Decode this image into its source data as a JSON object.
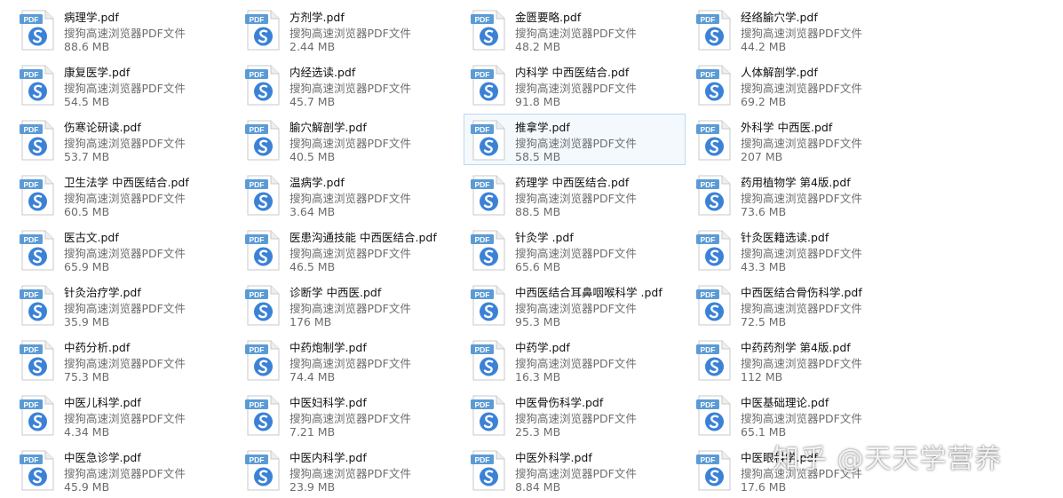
{
  "explorer": {
    "files": [
      {
        "name": "病理学.pdf",
        "type": "搜狗高速浏览器PDF文件",
        "size": "88.6 MB"
      },
      {
        "name": "康复医学.pdf",
        "type": "搜狗高速浏览器PDF文件",
        "size": "54.5 MB"
      },
      {
        "name": "伤寒论研读.pdf",
        "type": "搜狗高速浏览器PDF文件",
        "size": "53.7 MB"
      },
      {
        "name": "卫生法学 中西医结合.pdf",
        "type": "搜狗高速浏览器PDF文件",
        "size": "60.5 MB"
      },
      {
        "name": "医古文.pdf",
        "type": "搜狗高速浏览器PDF文件",
        "size": "65.9 MB"
      },
      {
        "name": "针灸治疗学.pdf",
        "type": "搜狗高速浏览器PDF文件",
        "size": "35.9 MB"
      },
      {
        "name": "中药分析.pdf",
        "type": "搜狗高速浏览器PDF文件",
        "size": "75.3 MB"
      },
      {
        "name": "中医儿科学.pdf",
        "type": "搜狗高速浏览器PDF文件",
        "size": "4.34 MB"
      },
      {
        "name": "中医急诊学.pdf",
        "type": "搜狗高速浏览器PDF文件",
        "size": "45.9 MB"
      },
      {
        "name": "方剂学.pdf",
        "type": "搜狗高速浏览器PDF文件",
        "size": "2.44 MB"
      },
      {
        "name": "内经选读.pdf",
        "type": "搜狗高速浏览器PDF文件",
        "size": "45.7 MB"
      },
      {
        "name": "腧穴解剖学.pdf",
        "type": "搜狗高速浏览器PDF文件",
        "size": "40.5 MB"
      },
      {
        "name": "温病学.pdf",
        "type": "搜狗高速浏览器PDF文件",
        "size": "3.64 MB"
      },
      {
        "name": "医患沟通技能 中西医结合.pdf",
        "type": "搜狗高速浏览器PDF文件",
        "size": "46.5 MB"
      },
      {
        "name": "诊断学 中西医.pdf",
        "type": "搜狗高速浏览器PDF文件",
        "size": "176 MB"
      },
      {
        "name": "中药炮制学.pdf",
        "type": "搜狗高速浏览器PDF文件",
        "size": "74.4 MB"
      },
      {
        "name": "中医妇科学.pdf",
        "type": "搜狗高速浏览器PDF文件",
        "size": "7.21 MB"
      },
      {
        "name": "中医内科学.pdf",
        "type": "搜狗高速浏览器PDF文件",
        "size": "23.9 MB"
      },
      {
        "name": "金匮要略.pdf",
        "type": "搜狗高速浏览器PDF文件",
        "size": "48.2 MB"
      },
      {
        "name": "内科学 中西医结合.pdf",
        "type": "搜狗高速浏览器PDF文件",
        "size": "91.8 MB"
      },
      {
        "name": "推拿学.pdf",
        "type": "搜狗高速浏览器PDF文件",
        "size": "58.5 MB",
        "selected": true
      },
      {
        "name": "药理学 中西医结合.pdf",
        "type": "搜狗高速浏览器PDF文件",
        "size": "88.5 MB"
      },
      {
        "name": "针灸学 .pdf",
        "type": "搜狗高速浏览器PDF文件",
        "size": "65.6 MB"
      },
      {
        "name": "中西医结合耳鼻咽喉科学 .pdf",
        "type": "搜狗高速浏览器PDF文件",
        "size": "95.3 MB"
      },
      {
        "name": "中药学.pdf",
        "type": "搜狗高速浏览器PDF文件",
        "size": "16.3 MB"
      },
      {
        "name": "中医骨伤科学.pdf",
        "type": "搜狗高速浏览器PDF文件",
        "size": "25.3 MB"
      },
      {
        "name": "中医外科学.pdf",
        "type": "搜狗高速浏览器PDF文件",
        "size": "8.84 MB"
      },
      {
        "name": "经络腧穴学.pdf",
        "type": "搜狗高速浏览器PDF文件",
        "size": "44.2 MB"
      },
      {
        "name": "人体解剖学.pdf",
        "type": "搜狗高速浏览器PDF文件",
        "size": "69.2 MB"
      },
      {
        "name": "外科学 中西医.pdf",
        "type": "搜狗高速浏览器PDF文件",
        "size": "207 MB"
      },
      {
        "name": "药用植物学  第4版.pdf",
        "type": "搜狗高速浏览器PDF文件",
        "size": "73.6 MB"
      },
      {
        "name": "针灸医籍选读.pdf",
        "type": "搜狗高速浏览器PDF文件",
        "size": "43.3 MB"
      },
      {
        "name": "中西医结合骨伤科学.pdf",
        "type": "搜狗高速浏览器PDF文件",
        "size": "72.5 MB"
      },
      {
        "name": "中药药剂学  第4版.pdf",
        "type": "搜狗高速浏览器PDF文件",
        "size": "112 MB"
      },
      {
        "name": "中医基础理论.pdf",
        "type": "搜狗高速浏览器PDF文件",
        "size": "65.1 MB"
      },
      {
        "name": "中医眼科学.pdf",
        "type": "搜狗高速浏览器PDF文件",
        "size": "17.6 MB"
      }
    ]
  },
  "icon": {
    "label": "PDF",
    "badge_color": "#5b9bd5",
    "accent": "#3b82d6"
  },
  "watermark": "知乎 @天天学营养"
}
